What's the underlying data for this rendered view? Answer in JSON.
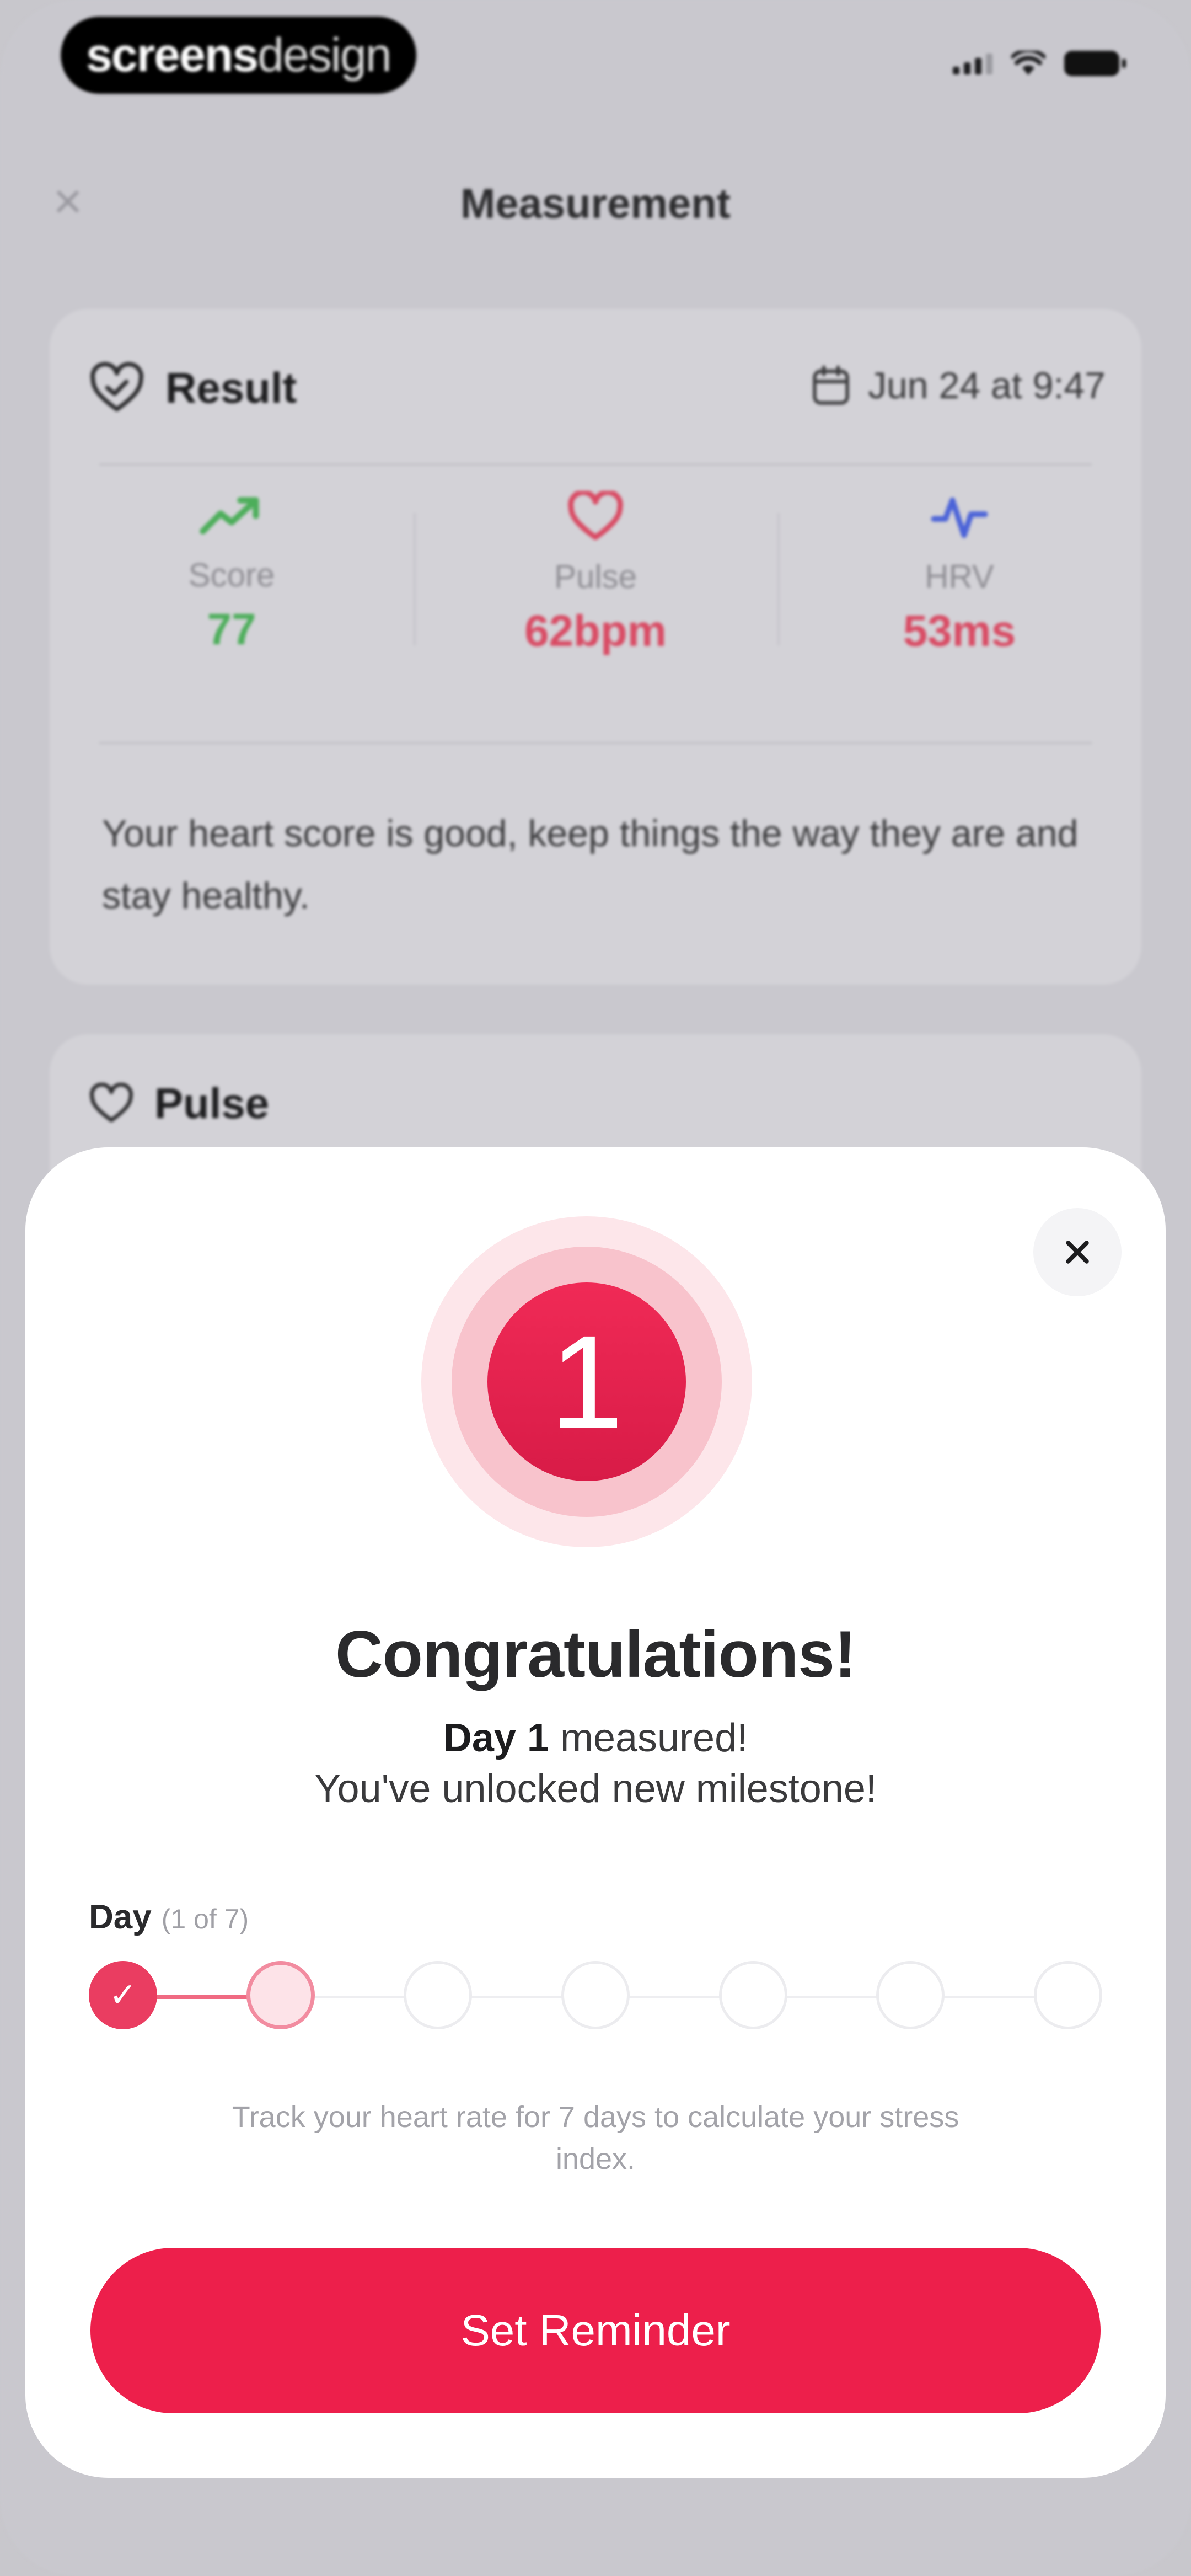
{
  "status_bar": {
    "brand_bold": "screens",
    "brand_light": "design"
  },
  "nav": {
    "title": "Measurement"
  },
  "result": {
    "title": "Result",
    "date": "Jun 24 at 9:47",
    "stats": [
      {
        "label": "Score",
        "value": "77",
        "icon": "trend-up-icon",
        "color": "#4cae5a"
      },
      {
        "label": "Pulse",
        "value": "62bpm",
        "icon": "heart-icon",
        "color": "#d94a63"
      },
      {
        "label": "HRV",
        "value": "53ms",
        "icon": "hrv-wave-icon",
        "color": "#d94a63"
      }
    ],
    "description": "Your heart score is good, keep things the way they are and stay healthy."
  },
  "pulse_card": {
    "title": "Pulse"
  },
  "modal": {
    "badge_number": "1",
    "title": "Congratulations!",
    "day_bold": "Day 1",
    "day_rest": " measured!",
    "subtitle": "You've unlocked new milestone!",
    "day_label": "Day",
    "day_progress": "(1 of 7)",
    "days_total": 7,
    "days_completed": 1,
    "hint": "Track your heart rate for 7 days to calculate your stress index.",
    "cta_label": "Set Reminder"
  },
  "colors": {
    "accent": "#ed1f4b",
    "score_green": "#4cae5a",
    "pulse_red": "#d94a63",
    "hrv_blue": "#4b63d8"
  }
}
